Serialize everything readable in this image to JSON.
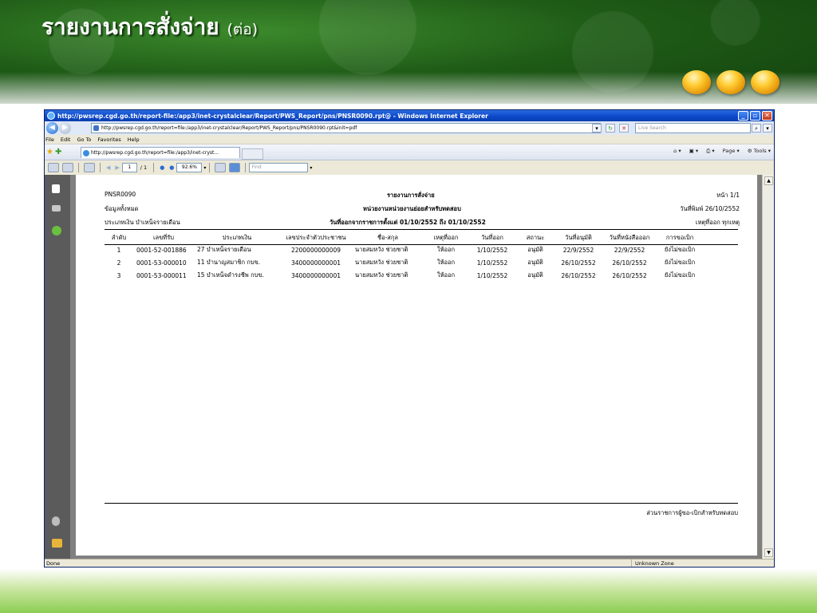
{
  "slide": {
    "title": "รายงานการสั่งจ่าย",
    "title_suffix": "(ต่อ)"
  },
  "browser": {
    "window_title": "http://pwsrep.cgd.go.th/report-file:/app3/inet-crystalclear/Report/PWS_Report/pns/PNSR0090.rpt@ - Windows Internet Explorer",
    "address": "http://pwsrep.cgd.go.th/report=file:/app3/inet-crystalclear/Report/PWS_Report/pns/PNSR0090.rpt&init=pdf",
    "search_placeholder": "Live Search",
    "menu": [
      "File",
      "Edit",
      "Go To",
      "Favorites",
      "Help"
    ],
    "tab_label": "http://pwsrep.cgd.go.th/report=file:/app3/inet-cryst...",
    "cmd_page": "Page",
    "cmd_tools": "Tools",
    "status_left": "Done",
    "status_zone": "Unknown Zone"
  },
  "pdf_toolbar": {
    "page_current": "1",
    "page_total": "/ 1",
    "zoom": "92.6%",
    "find_placeholder": "Find"
  },
  "report": {
    "code": "PNSR0090",
    "title": "รายงานการสั่งจ่าย",
    "page_label": "หน้า 1/1",
    "scope": "ข้อมูลทั้งหมด",
    "unit": "หน่วยงานหน่วยงานย่อยสำหรับทดสอบ",
    "print_date": "วันที่พิมพ์ 26/10/2552",
    "pay_type": "ประเภทเงิน บำเหน็จรายเดือน",
    "date_range": "วันที่ออกจากราชการตั้งแต่ 01/10/2552 ถึง 01/10/2552",
    "reason_filter": "เหตุที่ออก ทุกเหตุ",
    "columns": [
      "ลำดับ",
      "เลขที่รับ",
      "ประเภทเงิน",
      "เลขประจำตัวประชาชน",
      "ชื่อ-สกุล",
      "เหตุที่ออก",
      "วันที่ออก",
      "สถานะ",
      "วันที่อนุมัติ",
      "วันที่หนังสือออก",
      "การขอเบิก"
    ],
    "rows": [
      [
        "1",
        "0001-52-001886",
        "27 บำเหน็จรายเดือน",
        "2200000000009",
        "นายสมหวัง ช่วยชาติ",
        "ให้ออก",
        "1/10/2552",
        "อนุมัติ",
        "22/9/2552",
        "22/9/2552",
        "ยังไม่ขอเบิก"
      ],
      [
        "2",
        "0001-53-000010",
        "11 บำนาญสมาชิก กบข.",
        "3400000000001",
        "นายสมหวัง ช่วยชาติ",
        "ให้ออก",
        "1/10/2552",
        "อนุมัติ",
        "26/10/2552",
        "26/10/2552",
        "ยังไม่ขอเบิก"
      ],
      [
        "3",
        "0001-53-000011",
        "15 บำเหน็จดำรงชีพ กบข.",
        "3400000000001",
        "นายสมหวัง ช่วยชาติ",
        "ให้ออก",
        "1/10/2552",
        "อนุมัติ",
        "26/10/2552",
        "26/10/2552",
        "ยังไม่ขอเบิก"
      ]
    ],
    "footer": "ส่วนราชการผู้ขอ-เบิกสำหรับทดสอบ"
  },
  "colors": {
    "title_bar": "#0b47c8",
    "slide_green": "#1f5c17",
    "orb": "#ffcc33"
  }
}
